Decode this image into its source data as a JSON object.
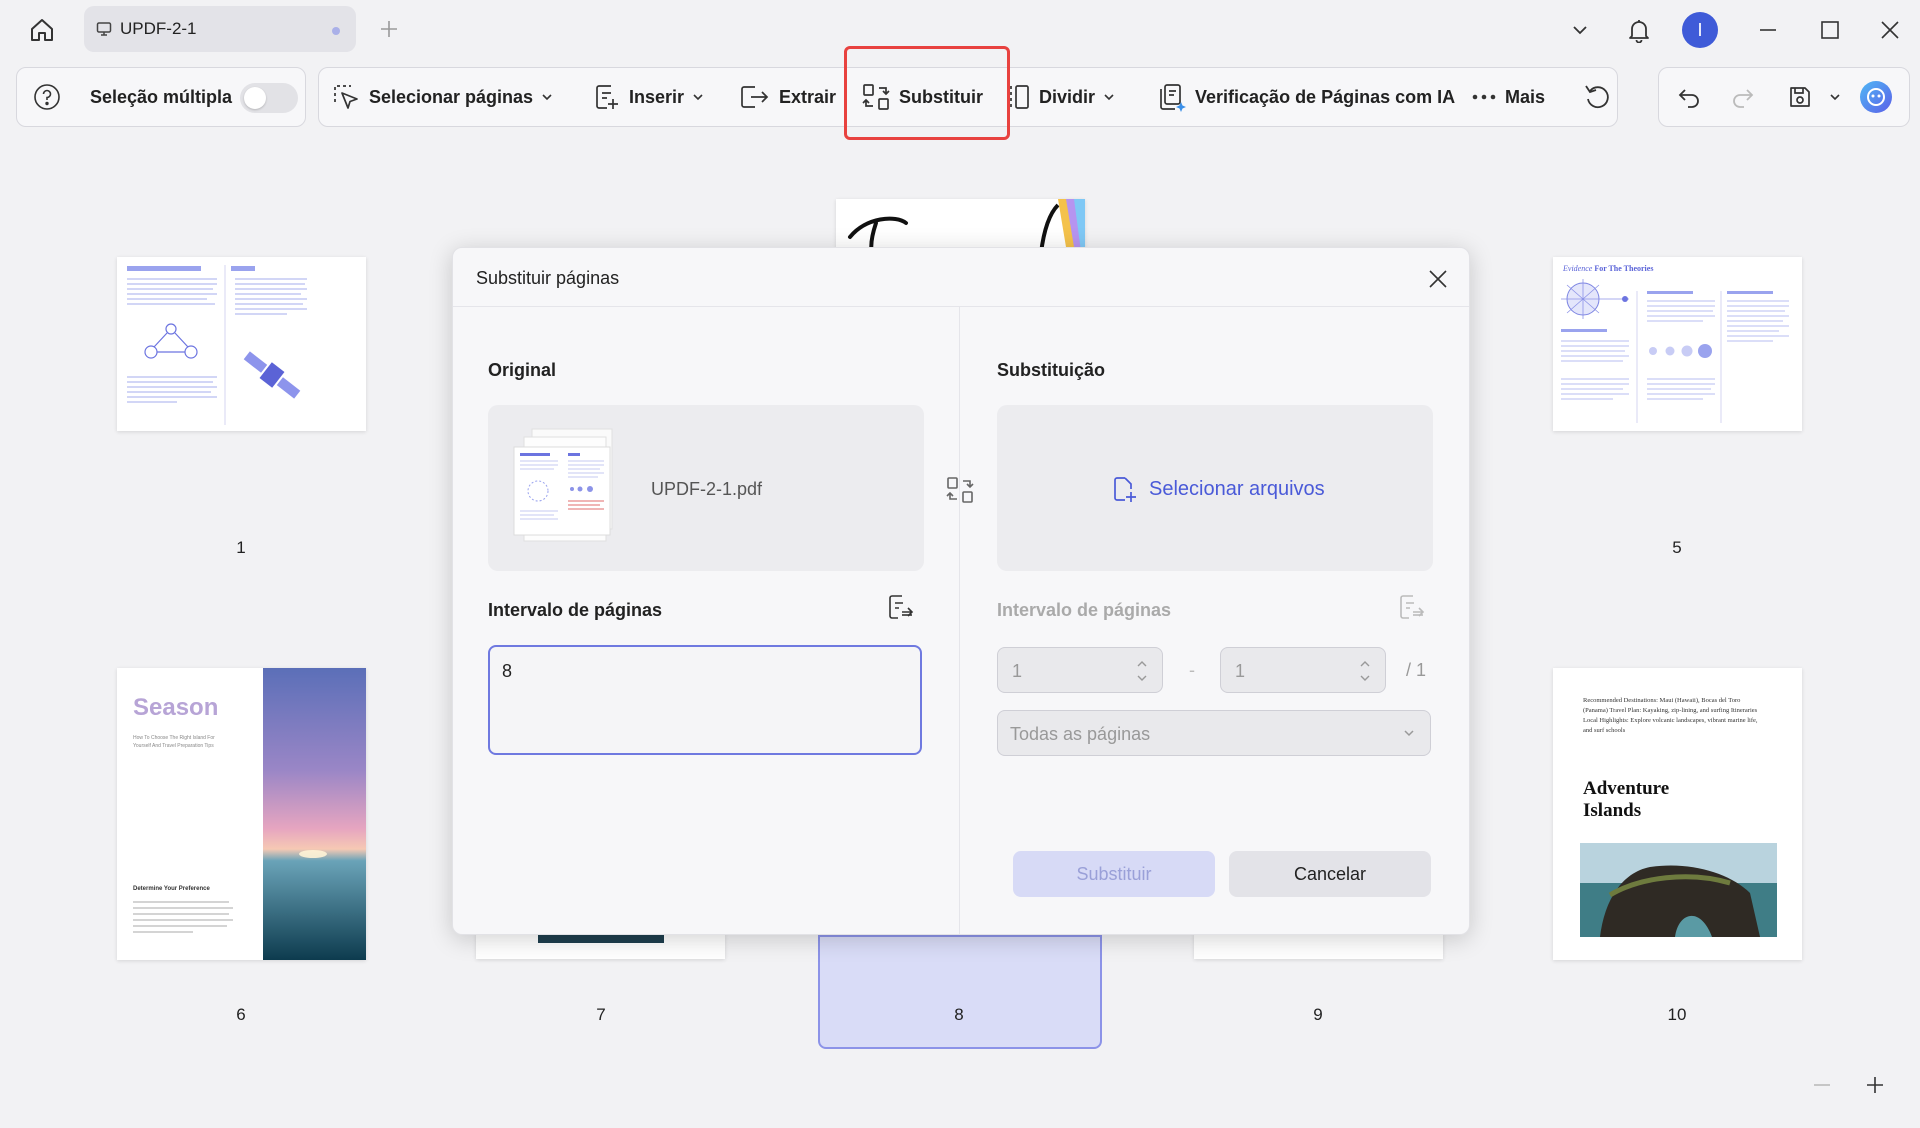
{
  "titlebar": {
    "tab_label": "UPDF-2-1",
    "avatar_letter": "I"
  },
  "toolbar": {
    "multi_select_label": "Seleção múltipla",
    "select_pages_label": "Selecionar páginas",
    "insert_label": "Inserir",
    "extract_label": "Extrair",
    "replace_label": "Substituir",
    "split_label": "Dividir",
    "ai_check_label": "Verificação de Páginas com IA",
    "more_label": "Mais"
  },
  "pages": {
    "numbers": {
      "p1": "1",
      "p5": "5",
      "p6": "6",
      "p7": "7",
      "p8": "8",
      "p9": "9",
      "p10": "10"
    },
    "p1_thumb": {},
    "p5_thumb": {
      "heading_italic": "Evidence",
      "heading_bold": "For The Theories"
    },
    "p6_thumb": {
      "title": "Season",
      "subtitle": "How To Choose The Right Island For Yourself And Travel Preparation Tips",
      "section": "Determine Your Preference"
    },
    "p10_thumb": {
      "intro": "Recommended Destinations: Maui (Hawaii), Bocas del Toro (Panama) Travel Plan: Kayaking, zip-lining, and surfing Itineraries Local Highlights: Explore volcanic landscapes, vibrant marine life, and surf schools",
      "title": "Adventure Islands"
    }
  },
  "modal": {
    "title": "Substituir páginas",
    "original_label": "Original",
    "replacement_label": "Substituição",
    "file_name": "UPDF-2-1.pdf",
    "select_files_label": "Selecionar arquivos",
    "range_label_left": "Intervalo de páginas",
    "range_value": "8",
    "range_label_right": "Intervalo de páginas",
    "from_value": "1",
    "dash": "-",
    "to_value": "1",
    "total": "/ 1",
    "all_pages_option": "Todas as páginas",
    "replace_button": "Substituir",
    "cancel_button": "Cancelar"
  },
  "colors": {
    "accent": "#4a5ad8",
    "highlight": "#e8423f",
    "selected_page_bg": "#d9dcf7"
  }
}
